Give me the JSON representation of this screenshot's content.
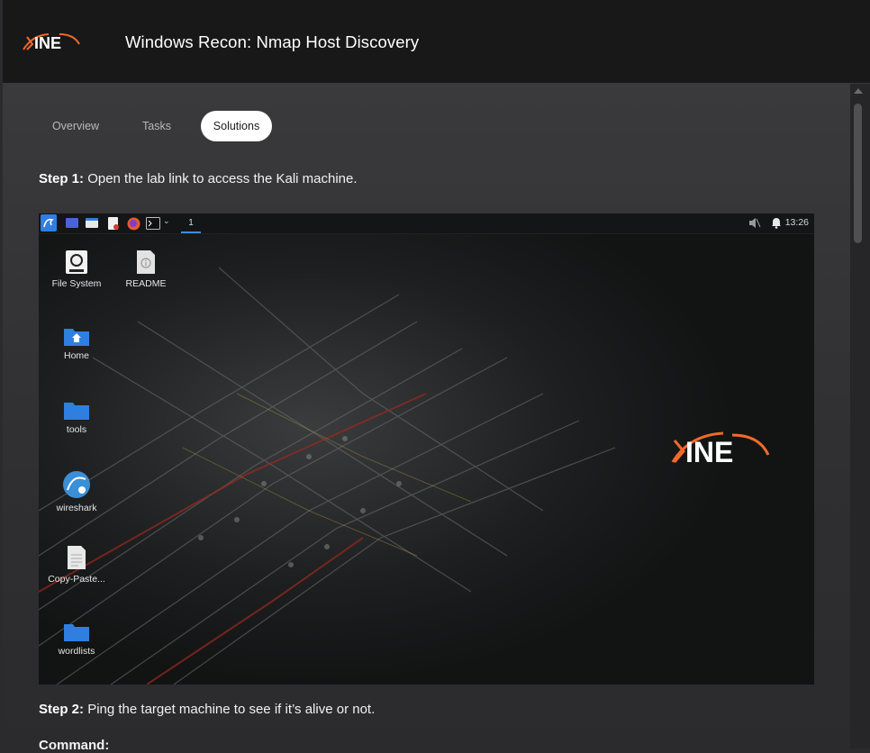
{
  "header": {
    "brand": "INE",
    "title": "Windows Recon: Nmap Host Discovery"
  },
  "tabs": [
    {
      "label": "Overview",
      "active": false
    },
    {
      "label": "Tasks",
      "active": false
    },
    {
      "label": "Solutions",
      "active": true
    }
  ],
  "steps": {
    "step1_label": "Step 1:",
    "step1_text": "Open the lab link to access the Kali machine.",
    "step2_label": "Step 2:",
    "step2_text": "Ping the target machine to see if it’s alive or not.",
    "command_label": "Command:"
  },
  "desktop": {
    "workspace": "1",
    "clock": "13:26",
    "icons": [
      {
        "label": "File System",
        "icon": "drive-icon"
      },
      {
        "label": "README",
        "icon": "info-file-icon"
      },
      {
        "label": "Home",
        "icon": "home-folder-icon"
      },
      {
        "label": "tools",
        "icon": "folder-icon"
      },
      {
        "label": "wireshark",
        "icon": "wireshark-icon"
      },
      {
        "label": "Copy-Paste...",
        "icon": "text-file-icon"
      },
      {
        "label": "wordlists",
        "icon": "folder-icon"
      }
    ],
    "wallpaper_logo": "INE"
  },
  "colors": {
    "accent_orange": "#f06a2a",
    "active_tab_bg": "#ffffff",
    "folder_blue": "#2f7fe0"
  }
}
